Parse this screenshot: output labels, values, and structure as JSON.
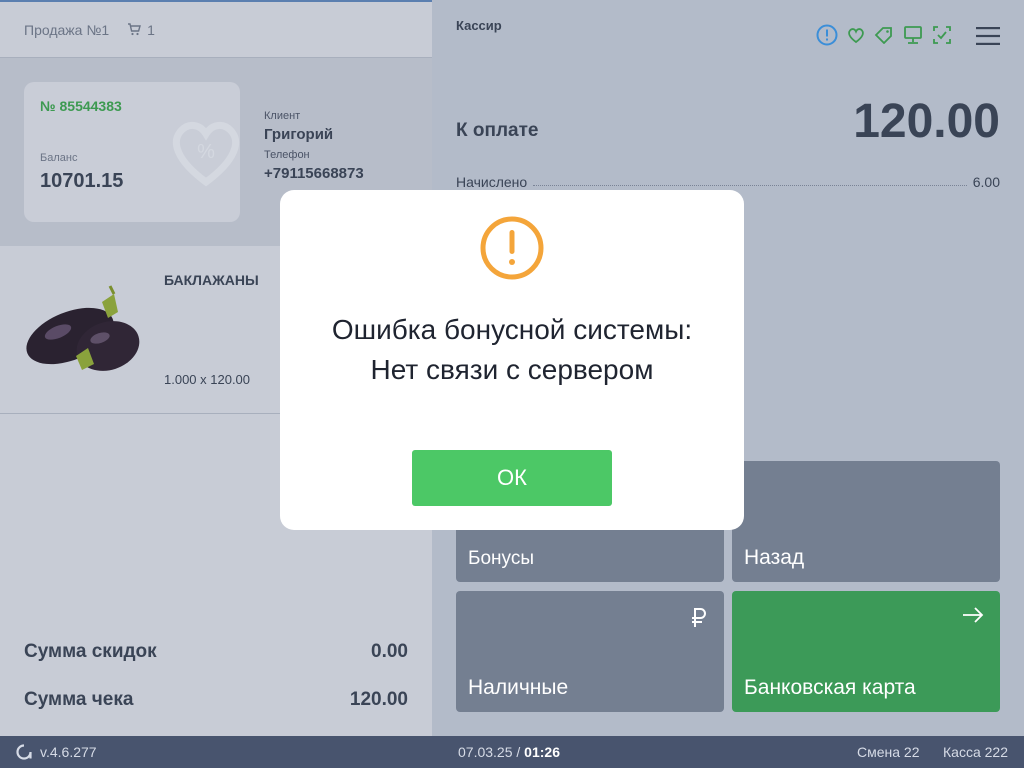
{
  "header": {
    "sale_title": "Продажа №1",
    "cart_count": "1"
  },
  "client": {
    "card_number": "№ 85544383",
    "balance_label": "Баланс",
    "balance": "10701.15",
    "client_label": "Клиент",
    "client_name": "Григорий",
    "phone_label": "Телефон",
    "phone": "+79115668873"
  },
  "product": {
    "name": "БАКЛАЖАНЫ",
    "qty_price": "1.000 x 120.00",
    "icon": "eggplant-image"
  },
  "totals": {
    "discount_label": "Сумма скидок",
    "discount_value": "0.00",
    "check_label": "Сумма чека",
    "check_value": "120.00"
  },
  "right": {
    "cashier": "Кассир",
    "pay_label": "К оплате",
    "pay_amount": "120.00",
    "accrued_label": "Начислено",
    "accrued_value": "6.00"
  },
  "buttons": {
    "bonus": "Бонусы",
    "back": "Назад",
    "cash": "Наличные",
    "card": "Банковская карта"
  },
  "status": {
    "version": "v.4.6.277",
    "date": "07.03.25 / ",
    "time": "01:26",
    "shift": "Смена 22",
    "kassa": "Касса 222"
  },
  "modal": {
    "message": "Ошибка бонусной системы: Нет связи с сервером",
    "ok_label": "ОК"
  },
  "colors": {
    "green": "#4cc866",
    "card_green": "#3d9a51",
    "tile_gray": "#747f91",
    "tile_green": "#3c9a58",
    "warning_orange": "#f4a53a",
    "status_bar": "#48546e"
  }
}
